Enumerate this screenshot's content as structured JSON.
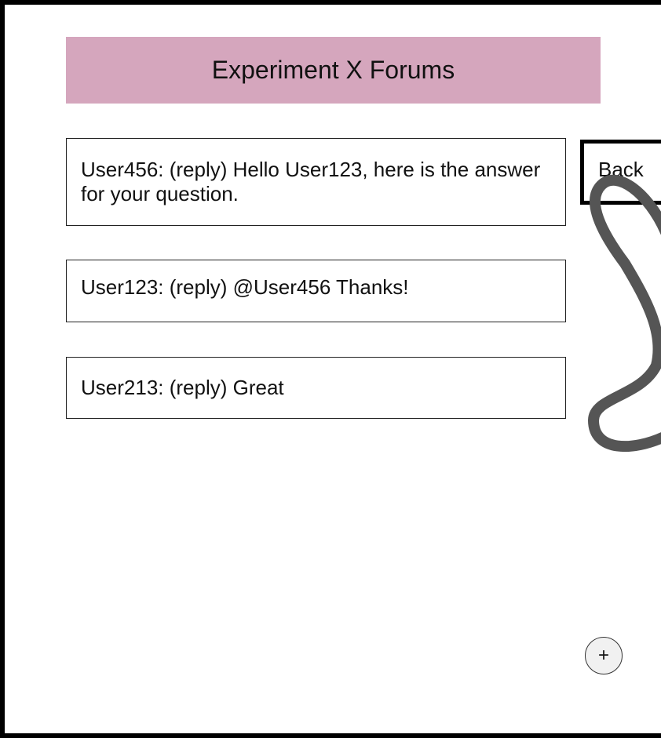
{
  "header": {
    "title": "Experiment X Forums",
    "color": "#d5a6bd"
  },
  "posts": [
    {
      "text": "User456: (reply) Hello User123,  here is the answer for your question."
    },
    {
      "text": "User123: (reply) @User456 Thanks!"
    },
    {
      "text": "User213: (reply) Great"
    }
  ],
  "back_button": {
    "label": "Back"
  },
  "add_button": {
    "label": "+",
    "icon": "plus-icon"
  },
  "annotation": {
    "icon": "scribble-arrow-icon",
    "color": "#555555"
  }
}
